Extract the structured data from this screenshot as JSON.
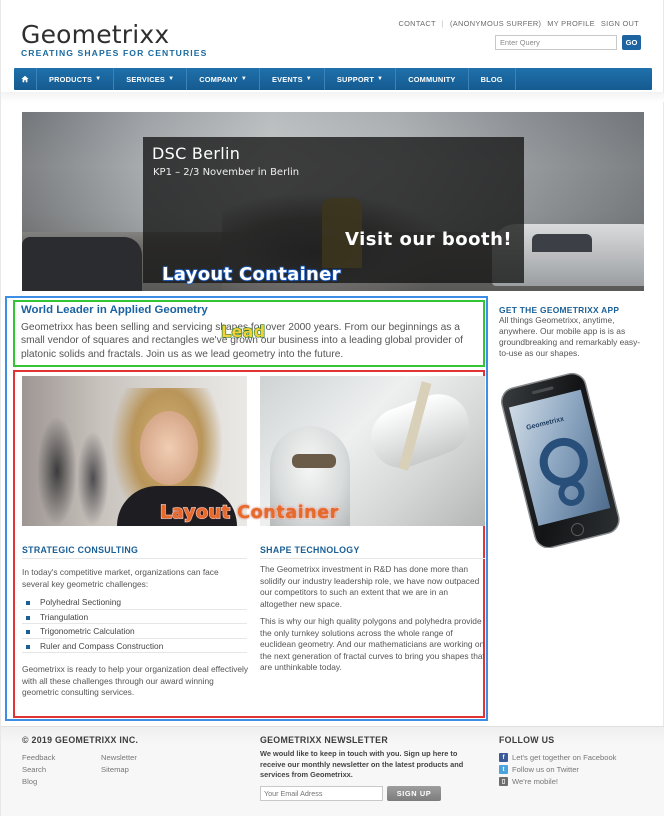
{
  "header": {
    "logo_title": "Geometrixx",
    "logo_tagline": "CREATING SHAPES FOR CENTURIES",
    "top_links": [
      "CONTACT",
      "(ANONYMOUS SURFER)",
      "MY PROFILE",
      "SIGN OUT"
    ],
    "search_placeholder": "Enter Query",
    "search_button": "GO"
  },
  "nav": {
    "items": [
      {
        "label": "PRODUCTS",
        "caret": "▼"
      },
      {
        "label": "SERVICES",
        "caret": "▼"
      },
      {
        "label": "COMPANY",
        "caret": "▼"
      },
      {
        "label": "EVENTS",
        "caret": "▼"
      },
      {
        "label": "SUPPORT",
        "caret": "▼"
      },
      {
        "label": "COMMUNITY",
        "caret": ""
      },
      {
        "label": "BLOG",
        "caret": ""
      }
    ]
  },
  "hero": {
    "title": "DSC Berlin",
    "subtitle": "KP1 – 2/3 November in Berlin",
    "cta": "Visit our booth!"
  },
  "annotations": {
    "outer_container": "Layout Container",
    "lead": "Lead",
    "inner_container": "Layout Container"
  },
  "lead": {
    "title": "World Leader in Applied Geometry",
    "text": "Geometrixx has been selling and servicing shapes for over 2000 years. From our beginnings as a small vendor of squares and rectangles we've grown our business into a leading global provider of platonic solids and fractals. Join us as we lead geometry into the future."
  },
  "strategic": {
    "heading": "STRATEGIC CONSULTING",
    "intro": "In today's competitive market, organizations can face several key geometric challenges:",
    "bullets": [
      "Polyhedral Sectioning",
      "Triangulation",
      "Trigonometric Calculation",
      "Ruler and Compass Construction"
    ],
    "outro": "Geometrixx is ready to help your organization deal effectively with all these challenges through our award winning geometric consulting services."
  },
  "shape": {
    "heading": "SHAPE TECHNOLOGY",
    "p1": "The Geometrixx investment in R&D has done more than solidify our industry leadership role, we have now outpaced our competitors to such an extent that we are in an altogether new space.",
    "p2": "This is why our high quality polygons and polyhedra provide the only turnkey solutions across the whole range of euclidean geometry. And our mathematicians are working on the next generation of fractal curves to bring you shapes that are unthinkable today."
  },
  "app": {
    "heading": "GET THE GEOMETRIXX APP",
    "text": "All things Geometrixx, anytime, anywhere. Our mobile app is is as groundbreaking and remarkably easy-to-use as our shapes.",
    "phone_brand": "Geometrixx"
  },
  "footer": {
    "copyright": "© 2019 GEOMETRIXX INC.",
    "links_col1": [
      "Feedback",
      "Search",
      "Blog"
    ],
    "links_col2": [
      "Newsletter",
      "Sitemap"
    ],
    "newsletter_heading": "GEOMETRIXX NEWSLETTER",
    "newsletter_text": "We would like to keep in touch with you. Sign up here to receive our monthly newsletter on the latest products and services from Geometrixx.",
    "email_placeholder": "Your Email Adress",
    "signup_button": "SIGN UP",
    "follow_heading": "FOLLOW US",
    "follow_items": [
      "Let's get together on Facebook",
      "Follow us on Twitter",
      "We're mobile!"
    ]
  },
  "colors": {
    "brand_blue": "#1a62a0",
    "nav_blue": "#1f71ac",
    "outer_box": "#3e8ee6",
    "lead_box": "#34c534",
    "inner_box": "#e23434"
  }
}
